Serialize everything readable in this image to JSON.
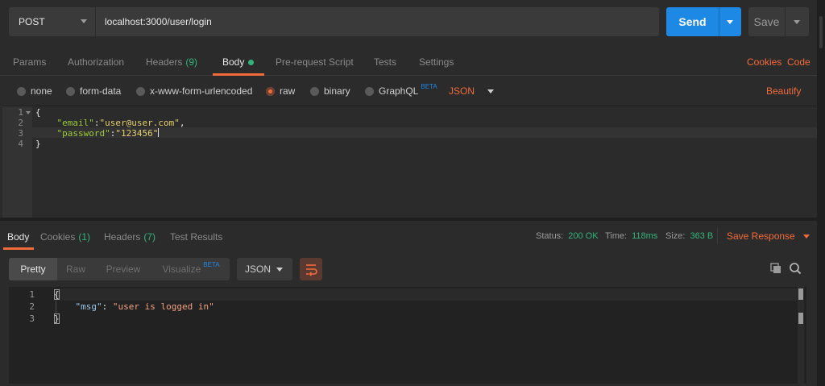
{
  "request": {
    "method": "POST",
    "url": "localhost:3000/user/login",
    "send_label": "Send",
    "save_label": "Save"
  },
  "tabs": [
    {
      "label": "Params"
    },
    {
      "label": "Authorization"
    },
    {
      "label": "Headers",
      "count": "(9)"
    },
    {
      "label": "Body"
    },
    {
      "label": "Pre-request Script"
    },
    {
      "label": "Tests"
    },
    {
      "label": "Settings"
    }
  ],
  "links": {
    "cookies": "Cookies",
    "code": "Code"
  },
  "body_types": [
    {
      "label": "none"
    },
    {
      "label": "form-data"
    },
    {
      "label": "x-www-form-urlencoded"
    },
    {
      "label": "raw",
      "checked": true
    },
    {
      "label": "binary"
    },
    {
      "label": "GraphQL",
      "badge": "BETA"
    }
  ],
  "raw_format": "JSON",
  "beautify": "Beautify",
  "request_body": {
    "line_numbers": [
      "1",
      "2",
      "3",
      "4"
    ],
    "open": "{",
    "email_key": "\"email\"",
    "email_val": "\"user@user.com\"",
    "password_key": "\"password\"",
    "password_val": "\"123456\"",
    "close": "}"
  },
  "response_tabs": [
    {
      "label": "Body"
    },
    {
      "label": "Cookies",
      "count": "(1)"
    },
    {
      "label": "Headers",
      "count": "(7)"
    },
    {
      "label": "Test Results"
    }
  ],
  "response_meta": {
    "status_label": "Status:",
    "status_value": "200 OK",
    "time_label": "Time:",
    "time_value": "118ms",
    "size_label": "Size:",
    "size_value": "363 B",
    "save_response": "Save Response"
  },
  "view_modes": [
    {
      "label": "Pretty"
    },
    {
      "label": "Raw"
    },
    {
      "label": "Preview"
    },
    {
      "label": "Visualize",
      "badge": "BETA"
    }
  ],
  "response_format": "JSON",
  "response_body": {
    "line_numbers": [
      "1",
      "2",
      "3"
    ],
    "open": "{",
    "msg_key": "\"msg\"",
    "msg_val": "\"user is logged in\"",
    "close": "}"
  },
  "icons": {
    "copy": "copy-icon",
    "search": "search-icon",
    "wrap": "wrap-lines-icon"
  },
  "colors": {
    "accent": "#f26b3a",
    "send": "#1e88e5",
    "success": "#2fb57a"
  }
}
